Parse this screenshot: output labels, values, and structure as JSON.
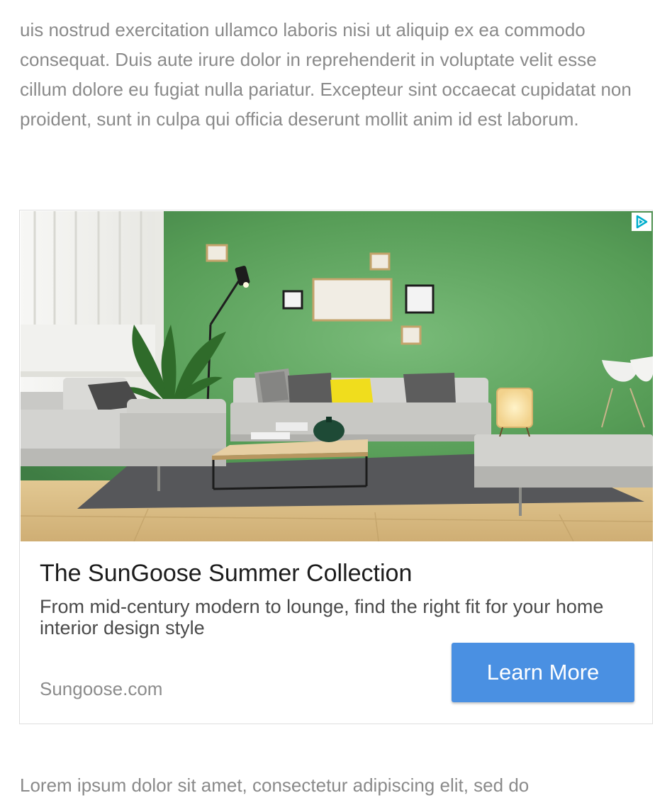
{
  "article": {
    "paragraph_top": "uis nostrud exercitation ullamco laboris nisi ut aliquip ex ea commodo consequat. Duis aute irure dolor in reprehenderit in voluptate velit esse cillum dolore eu fugiat nulla pariatur. Excepteur sint occaecat cupidatat non proident, sunt in culpa qui officia deserunt mollit anim id est laborum.",
    "paragraph_bottom": "Lorem ipsum dolor sit amet, consectetur adipiscing elit, sed do"
  },
  "ad": {
    "title": "The SunGoose Summer Collection",
    "description": "From mid-century modern to lounge, find the right fit for your home interior design style",
    "domain": "Sungoose.com",
    "cta_label": "Learn More",
    "adchoices_icon": "adchoices-icon",
    "colors": {
      "cta_background": "#4a90e2",
      "cta_text": "#ffffff",
      "wall": "#5aa25a",
      "adchoices": "#00aecd"
    }
  }
}
